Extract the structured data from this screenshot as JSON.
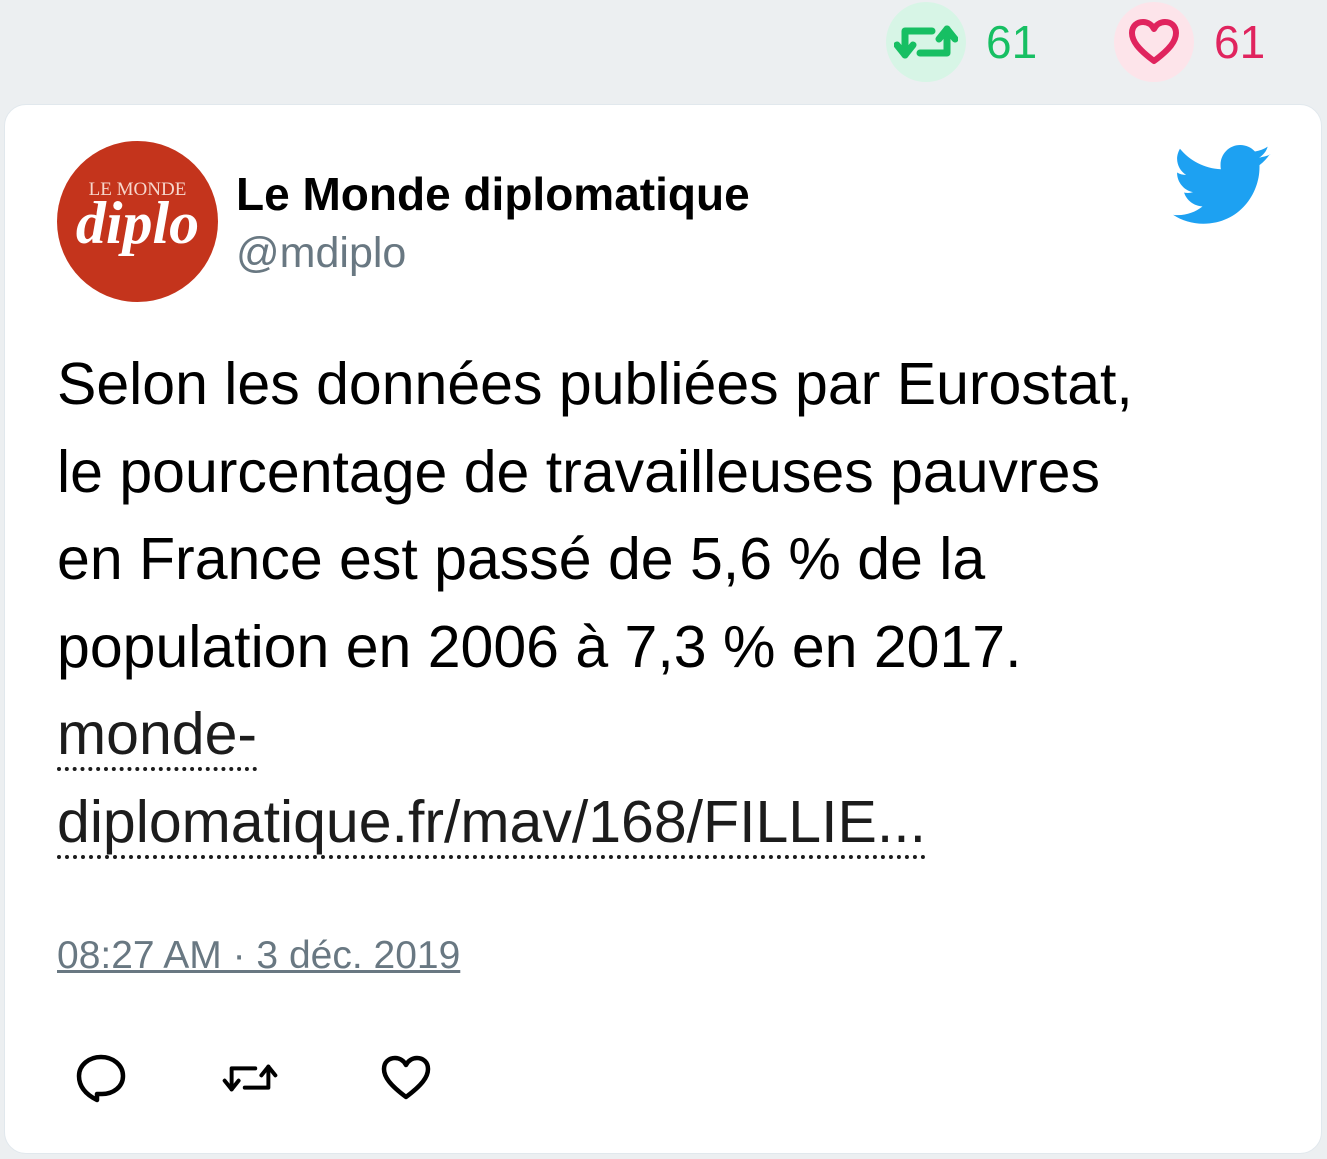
{
  "stats": {
    "retweet_count": "61",
    "like_count": "61",
    "retweet_color": "#17bf63",
    "like_color": "#e0245e"
  },
  "author": {
    "name": "Le Monde diplomatique",
    "handle": "@mdiplo",
    "avatar_text_top": "LE MONDE",
    "avatar_text_main": "diplo",
    "avatar_color": "#c4341c"
  },
  "tweet": {
    "lines": [
      "Selon les données publiées par Eurostat,",
      "le pourcentage de travailleuses pauvres",
      "en France est passé de 5,6 % de la",
      "population en 2006 à 7,3 % en 2017."
    ],
    "link_line_1": "monde-",
    "link_line_2": "diplomatique.fr/mav/168/FILLIE...",
    "timestamp": "08:27 AM · 3 déc. 2019"
  },
  "icons": {
    "retweet": "retweet-icon",
    "like": "heart-icon",
    "reply": "reply-icon",
    "brand": "twitter-bird-icon",
    "brand_color": "#1da1f2"
  }
}
